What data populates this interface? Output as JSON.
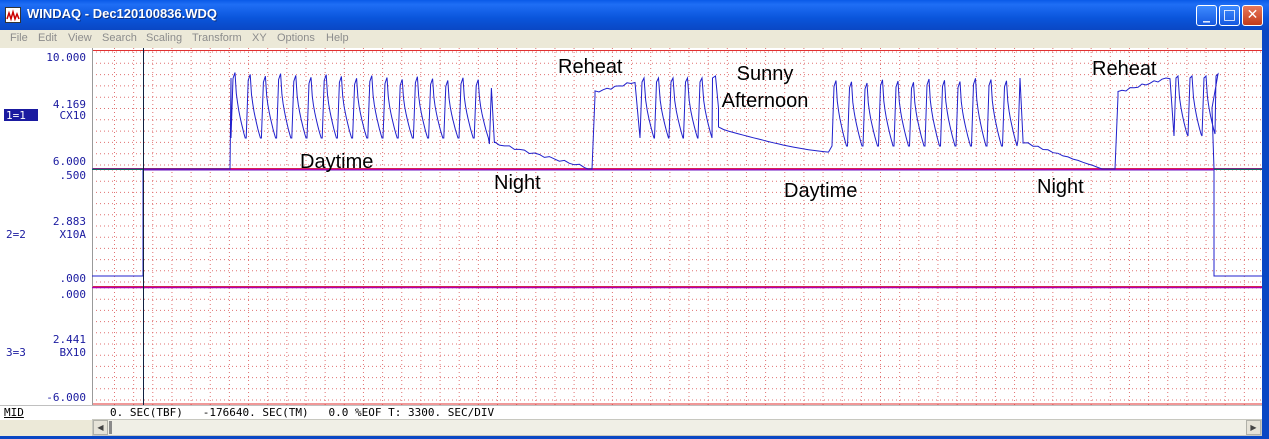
{
  "window": {
    "title": "WINDAQ - Dec120100836.WDQ"
  },
  "menu": [
    "File",
    "Edit",
    "View",
    "Search",
    "Scaling",
    "Transform",
    "XY",
    "Options",
    "Help"
  ],
  "channels": [
    {
      "id": "1=1",
      "name": "CX10",
      "top": "10.000",
      "mid": "4.169",
      "bottom": "6.000"
    },
    {
      "id": "2=2",
      "name": "X10A",
      "top": ".500",
      "mid": "2.883",
      "bottom": ".000"
    },
    {
      "id": "3=3",
      "name": "BX10",
      "top": ".000",
      "mid": "2.441",
      "bottom": "-6.000"
    }
  ],
  "annotations": [
    "Daytime",
    "Night",
    "Reheat",
    "Sunny Afternoon",
    "Daytime",
    "Night",
    "Reheat"
  ],
  "status": {
    "mode": "MID",
    "readout": "0. SEC(TBF)   -176640. SEC(TM)   0.0 %EOF T: 3300. SEC/DIV"
  },
  "colors": {
    "waveform": "#2020cc",
    "magenta_trace": "#b000b0",
    "green_trace": "#00c000",
    "grid": "#e07070",
    "labels": "#1a1aa0",
    "title_bar": "#0a55db"
  }
}
